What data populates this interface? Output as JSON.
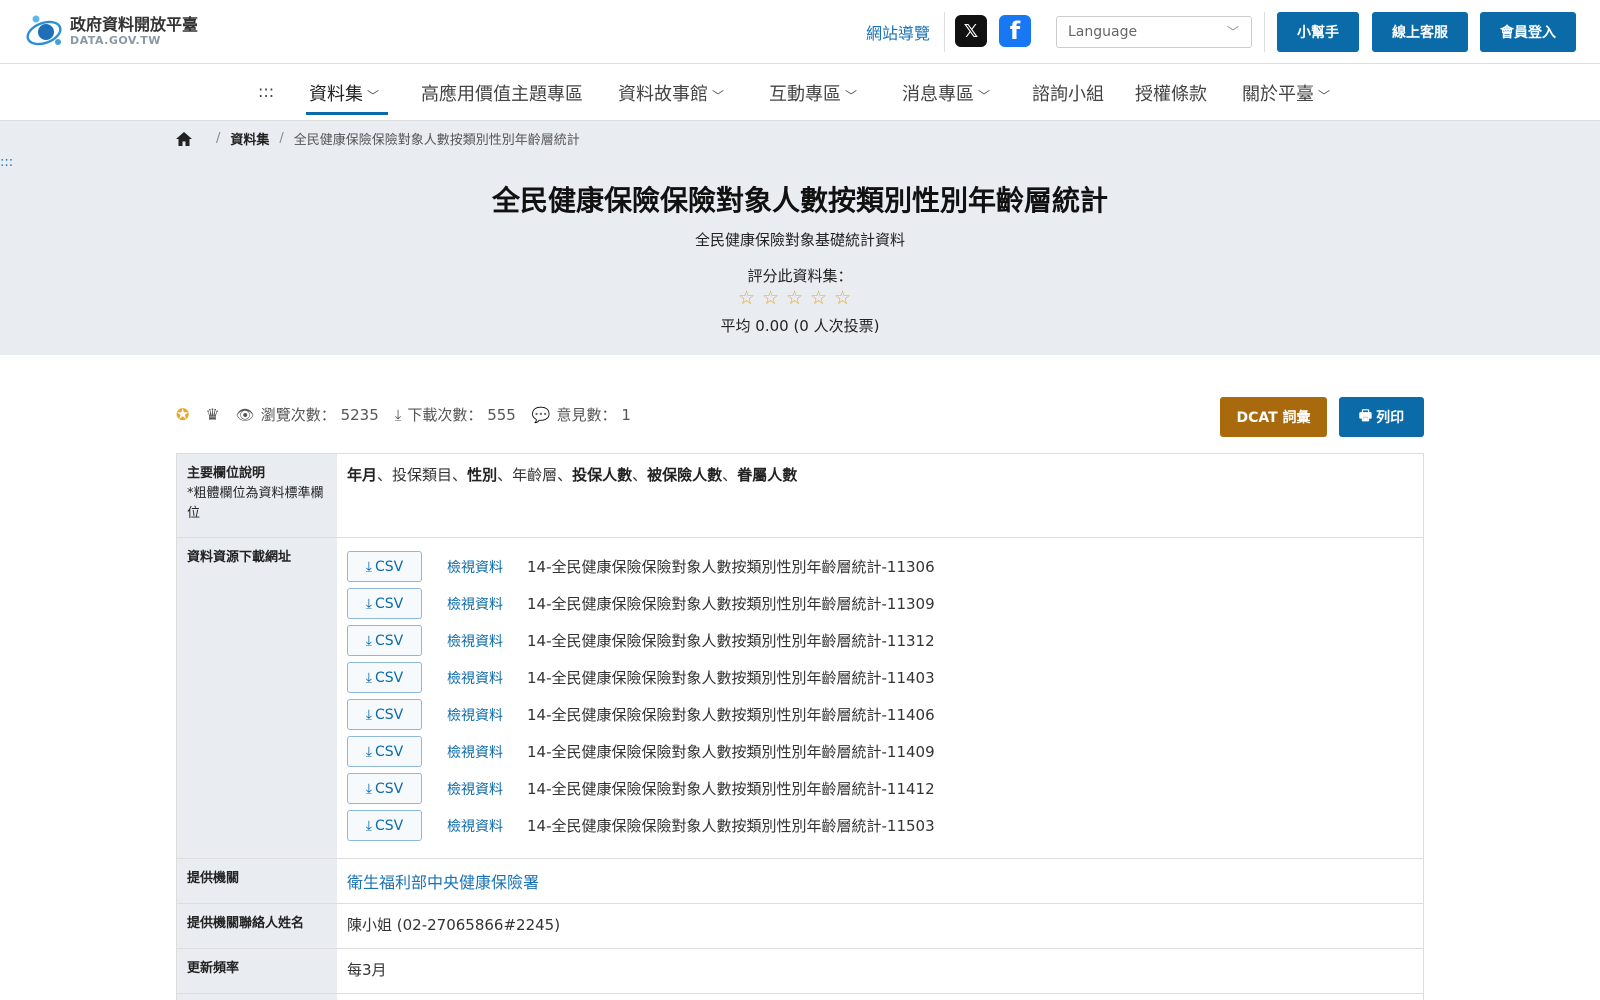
{
  "header": {
    "logo_title": "政府資料開放平臺",
    "logo_sub": "DATA.GOV.TW",
    "sitemap": "網站導覽",
    "language_placeholder": "Language",
    "btn_help": "小幫手",
    "btn_service": "線上客服",
    "btn_login": "會員登入"
  },
  "nav": {
    "skip": ":::",
    "items": [
      {
        "label": "資料集"
      },
      {
        "label": "高應用價值主題專區"
      },
      {
        "label": "資料故事館"
      },
      {
        "label": "互動專區"
      },
      {
        "label": "消息專區"
      },
      {
        "label": "諮詢小組"
      },
      {
        "label": "授權條款"
      },
      {
        "label": "關於平臺"
      }
    ]
  },
  "breadcrumb": {
    "dataset": "資料集",
    "current": "全民健康保險保險對象人數按類別性別年齡層統計"
  },
  "hero": {
    "skip": ":::",
    "title": "全民健康保險保險對象人數按類別性別年齡層統計",
    "subtitle": "全民健康保險對象基礎統計資料",
    "rate_label": "評分此資料集：",
    "rating_value": 0,
    "rating_max": 5,
    "average": "平均 0.00 (0 人次投票)"
  },
  "stats": {
    "views_label": "瀏覽次數：",
    "views": "5235",
    "downloads_label": "下載次數：",
    "downloads": "555",
    "comments_label": "意見數：",
    "comments": "1",
    "dcat": "DCAT 詞彙",
    "print": "列印"
  },
  "table": {
    "fields_th": "主要欄位說明",
    "fields_note": "*粗體欄位為資料標準欄位",
    "fields": {
      "f1": "年月",
      "s1": "、",
      "f2": "投保類目",
      "s2": "、",
      "f3": "性別",
      "s3": "、",
      "f4": "年齡層",
      "s4": "、",
      "f5": "投保人數",
      "s5": "、",
      "f6": "被保險人數",
      "s6": "、",
      "f7": "眷屬人數"
    },
    "resources_th": "資料資源下載網址",
    "csv_label": "CSV",
    "view_label": "檢視資料",
    "resources": [
      "14-全民健康保險保險對象人數按類別性別年齡層統計-11306",
      "14-全民健康保險保險對象人數按類別性別年齡層統計-11309",
      "14-全民健康保險保險對象人數按類別性別年齡層統計-11312",
      "14-全民健康保險保險對象人數按類別性別年齡層統計-11403",
      "14-全民健康保險保險對象人數按類別性別年齡層統計-11406",
      "14-全民健康保險保險對象人數按類別性別年齡層統計-11409",
      "14-全民健康保險保險對象人數按類別性別年齡層統計-11412",
      "14-全民健康保險保險對象人數按類別性別年齡層統計-11503"
    ],
    "org_th": "提供機關",
    "org": "衛生福利部中央健康保險署",
    "contact_th": "提供機關聯絡人姓名",
    "contact": "陳小姐 (02-27065866#2245)",
    "freq_th": "更新頻率",
    "freq": "每3月"
  },
  "colors": {
    "primary": "#0b6aa8",
    "dcat": "#a86a0c",
    "hero_bg": "#e9ecf1",
    "star": "#e2a92a"
  }
}
